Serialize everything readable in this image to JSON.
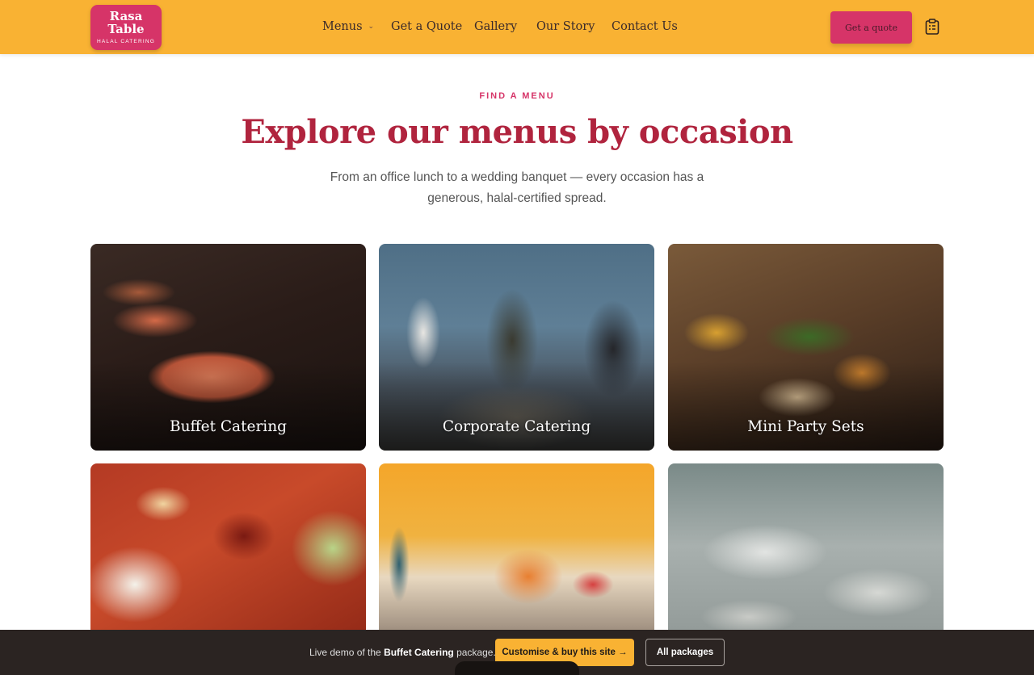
{
  "header": {
    "logo": {
      "name_line1": "Rasa",
      "name_line2": "Table",
      "tagline": "HALAL CATERING"
    },
    "nav": [
      {
        "label": "Menus"
      },
      {
        "label": "Get a Quote"
      },
      {
        "label": "Gallery"
      },
      {
        "label": "Our Story"
      },
      {
        "label": "Contact Us"
      }
    ],
    "cta_label": "Get a quote",
    "clipboard_icon": "clipboard-list-icon",
    "colors": {
      "background": "#f9b233",
      "accent": "#d63468"
    }
  },
  "hero": {
    "eyebrow": "FIND A MENU",
    "title": "Explore our menus by occasion",
    "subtitle": "From an office lunch to a wedding banquet — every occasion has a generous, halal-certified spread.",
    "title_color": "#b0243e"
  },
  "menus": [
    {
      "label": "Buffet Catering"
    },
    {
      "label": "Corporate Catering"
    },
    {
      "label": "Mini Party Sets"
    },
    {
      "label": ""
    },
    {
      "label": ""
    },
    {
      "label": ""
    }
  ],
  "demo_bar": {
    "prefix": "Live demo of the ",
    "package": "Buffet Catering",
    "suffix": " package.",
    "buy_label": "Customise & buy this site →",
    "packages_label": "All packages"
  }
}
